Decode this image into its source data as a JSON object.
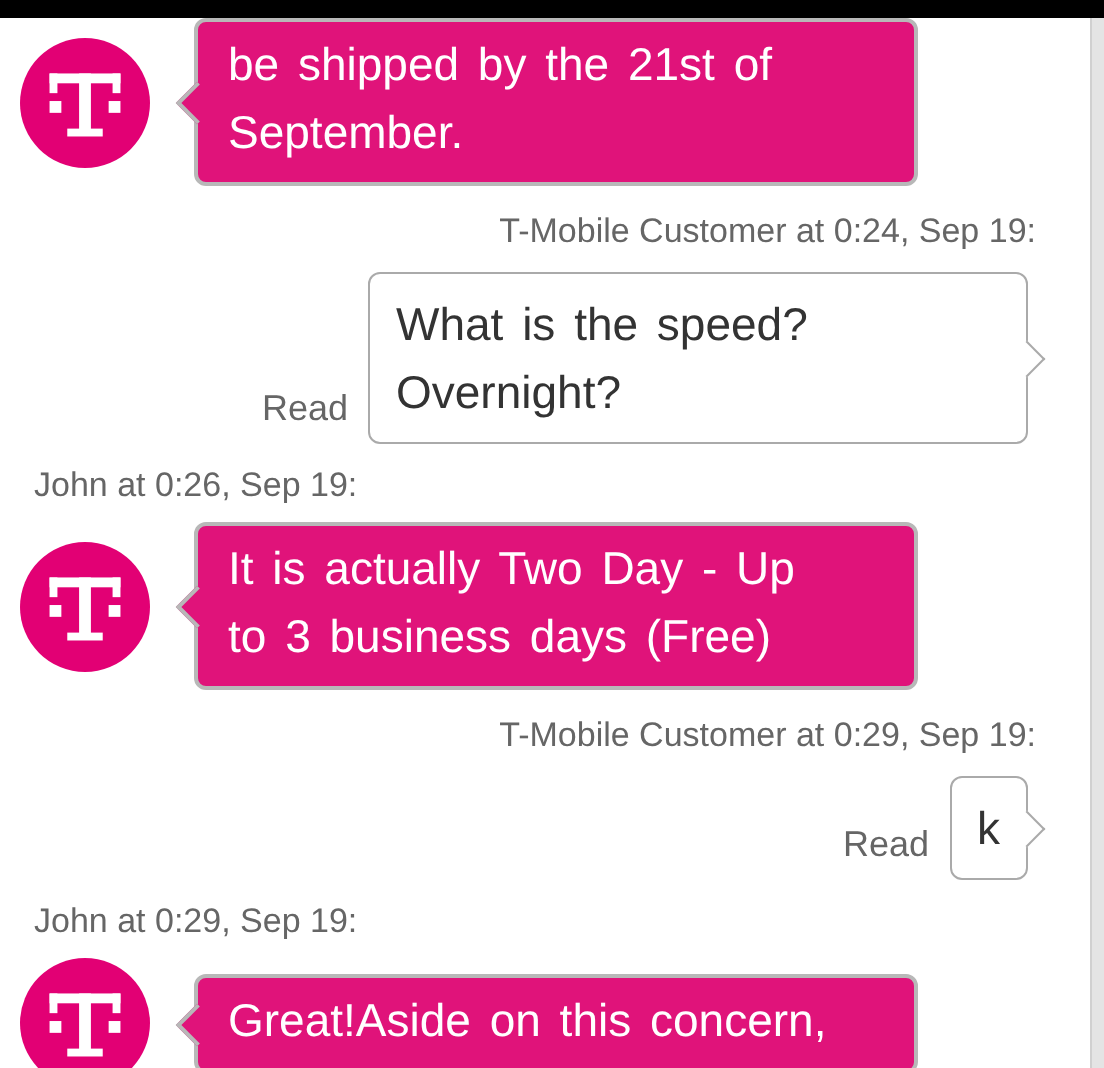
{
  "messages": [
    {
      "kind": "agent",
      "text": "be shipped by the 21st of September."
    },
    {
      "kind": "customer_header",
      "text": "T-Mobile Customer at 0:24, Sep 19:"
    },
    {
      "kind": "customer",
      "status": "Read",
      "text": "What is the speed? Overnight?"
    },
    {
      "kind": "agent_header",
      "text": "John at 0:26, Sep 19:"
    },
    {
      "kind": "agent",
      "text": "It is actually Two Day - Up to 3 business days (Free)"
    },
    {
      "kind": "customer_header",
      "text": "T-Mobile Customer at 0:29, Sep 19:"
    },
    {
      "kind": "customer",
      "status": "Read",
      "text": "k"
    },
    {
      "kind": "agent_header",
      "text": "John at 0:29, Sep 19:"
    },
    {
      "kind": "agent",
      "text": "Great!Aside on this concern,"
    }
  ]
}
